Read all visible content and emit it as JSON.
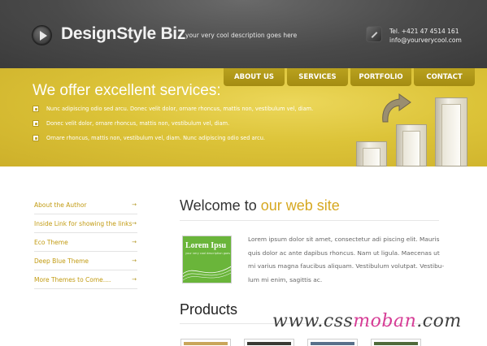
{
  "header": {
    "logo": "DesignStyle Biz",
    "tagline": "your very cool description goes here",
    "phone": "Tel. +421 47 4514 161",
    "email": "info@yourverycool.com"
  },
  "nav": [
    "ABOUT US",
    "SERVICES",
    "PORTFOLIO",
    "CONTACT"
  ],
  "banner": {
    "title": "We offer excellent services:",
    "bullets": [
      "Nunc adipiscing odio sed arcu. Donec velit dolor, ornare rhoncus, mattis non, vestibulum vel, diam.",
      "Donec velit dolor, ornare rhoncus, mattis non, vestibulum vel, diam.",
      "Ornare rhoncus, mattis non, vestibulum vel, diam. Nunc adipiscing odio sed arcu."
    ]
  },
  "sidebar": {
    "links": [
      "About the Author",
      "Inside Link for showing the links",
      "Eco Theme",
      "Deep Blue Theme",
      "More Themes to Come...."
    ],
    "arrow_glyph": "→"
  },
  "main": {
    "welcome_prefix": "Welcome to",
    "welcome_highlight": "our web site",
    "thumbnail_title": "Lorem Ipsu",
    "thumbnail_sub": "your very cool description goes",
    "body_lines": [
      "Lorem ipsum dolor sit amet, consectetur adi piscing elit. Mauris",
      "quis dolor ac ante dapibus rhoncus. Nam ut ligula. Maecenas ut",
      "mi varius magna faucibus aliquam. Vestibulum volutpat. Vestibu-",
      "lum mi enim, sagittis ac."
    ],
    "products_heading": "Products"
  },
  "watermark": {
    "part1": "www.css",
    "part2": "moban",
    "part3": ".com"
  },
  "colors": {
    "header_dark": "#4a4a4a",
    "banner_yellow": "#dcc338",
    "nav_tab": "#a48c12",
    "accent_gold": "#d6a820",
    "thumb_green": "#6ab53a",
    "watermark_pink": "#d63c95"
  }
}
